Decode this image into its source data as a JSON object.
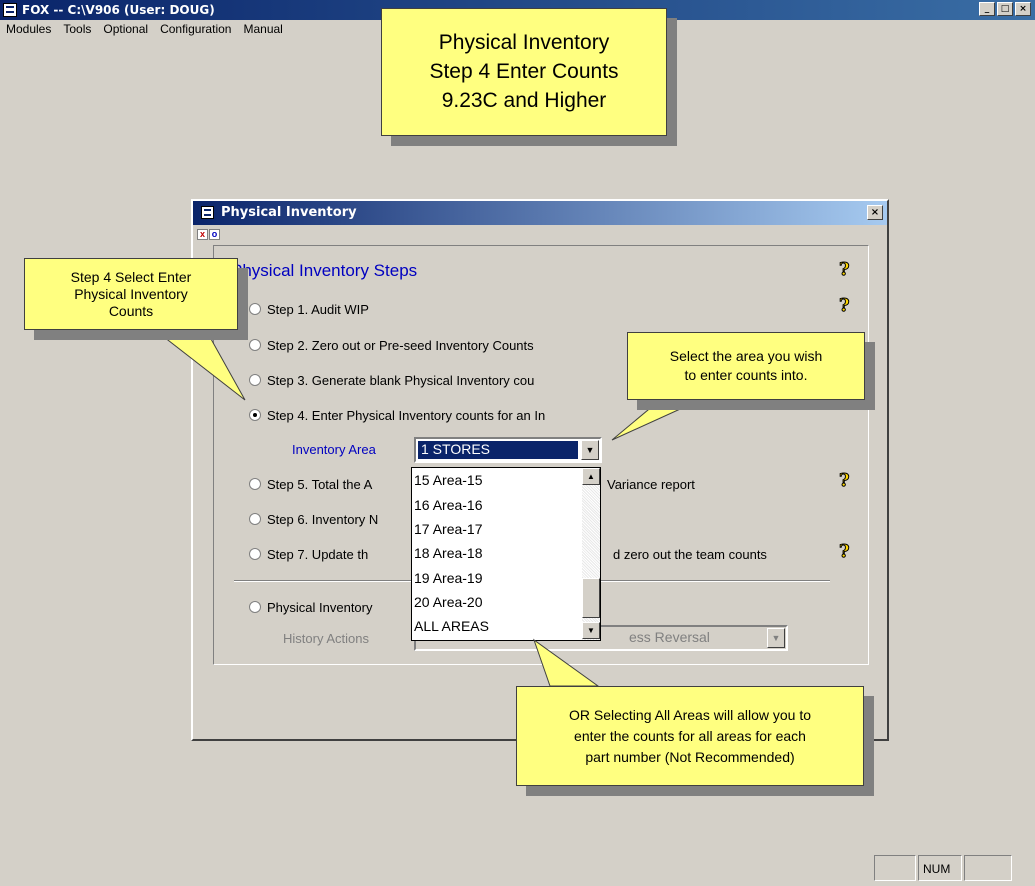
{
  "app": {
    "title": "FOX -- C:\\V906  (User: DOUG)",
    "window_buttons": [
      "_",
      "□",
      "×"
    ]
  },
  "menu": [
    "Modules",
    "Tools",
    "Optional",
    "Configuration",
    "Manual"
  ],
  "callouts": {
    "banner": [
      "Physical Inventory",
      "Step 4 Enter Counts",
      "9.23C and Higher"
    ],
    "step4": [
      "Step 4 Select Enter",
      "Physical Inventory",
      "Counts"
    ],
    "area": [
      "Select the area you wish",
      "to enter counts into."
    ],
    "all_areas": [
      "OR Selecting All Areas will allow you to",
      "enter the counts for all areas for each",
      "part number (Not Recommended)"
    ]
  },
  "dialog": {
    "title": "Physical Inventory",
    "close": "×",
    "group_title": "Physical Inventory Steps",
    "steps": [
      {
        "label": "Step 1.  Audit WIP",
        "selected": false
      },
      {
        "label": "Step 2.  Zero out or Pre-seed Inventory Counts",
        "selected": false
      },
      {
        "label": "Step 3.  Generate blank Physical Inventory cou",
        "selected": false
      },
      {
        "label": "Step 4.  Enter Physical Inventory counts for an In",
        "selected": true
      },
      {
        "label": "Step 5.  Total the A",
        "selected": false,
        "tail": "Variance report"
      },
      {
        "label": "Step 6.  Inventory N",
        "selected": false
      },
      {
        "label": "Step 7.  Update th",
        "selected": false,
        "tail": "d zero out the team counts"
      },
      {
        "label": "Physical Inventory",
        "selected": false
      }
    ],
    "inventory_area_label": "Inventory Area",
    "inventory_area_value": "1  STORES",
    "history_label": "History Actions",
    "history_value": "ess Reversal",
    "dropdown_items": [
      "15 Area-15",
      "16 Area-16",
      "17 Area-17",
      "18 Area-18",
      "19 Area-19",
      "20 Area-20",
      "ALL AREAS"
    ]
  },
  "status": {
    "num": "NUM"
  },
  "colors": {
    "callout_bg": "#ffff80",
    "titlebar": "#0a246a",
    "group_title": "#0000c0",
    "selection": "#0a246a"
  }
}
